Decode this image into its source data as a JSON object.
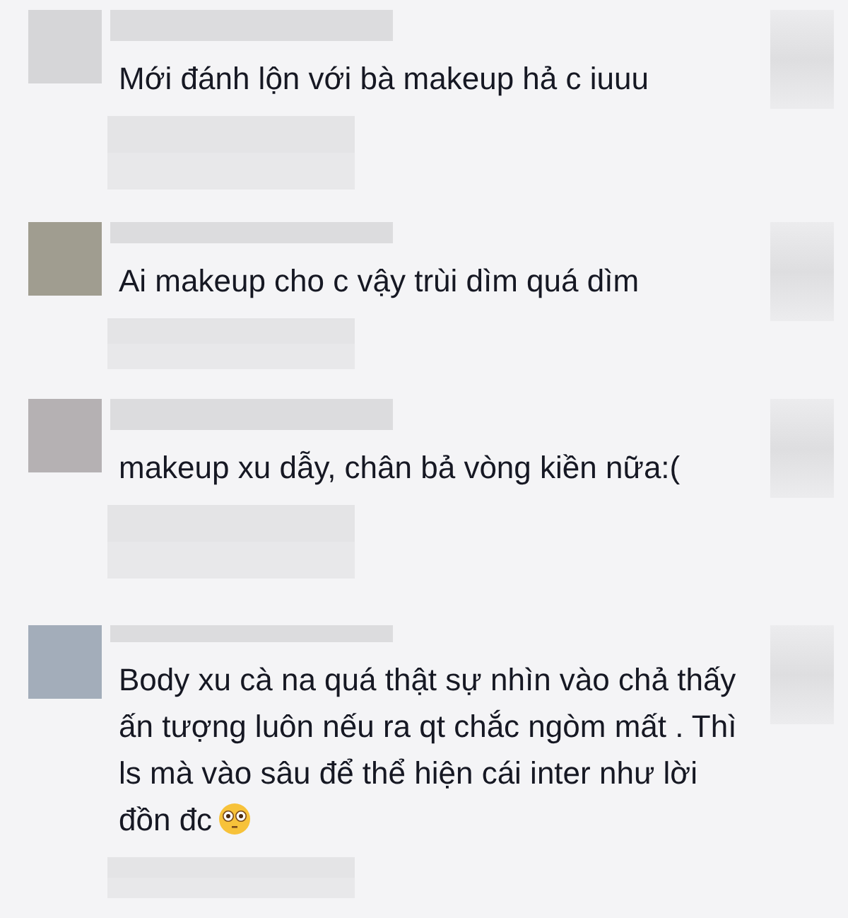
{
  "comments": [
    {
      "color": "#d6d6d8",
      "text": "Mới đánh lộn với bà makeup hả c iuuu",
      "emoji": false
    },
    {
      "color": "#a09d90",
      "text": "Ai makeup cho c vậy trùi dìm quá dìm",
      "emoji": false
    },
    {
      "color": "#b5b1b3",
      "text": "makeup xu dẫy, chân bả vòng kiền nữa:(",
      "emoji": false
    },
    {
      "color": "#a3adba",
      "text": "Body xu cà na quá thật sự nhìn vào chả thấy ấn tượng luôn nếu ra qt chắc ngòm mất . Thì ls mà vào sâu để thể hiện cái inter như lời đồn đc",
      "emoji": true
    }
  ]
}
